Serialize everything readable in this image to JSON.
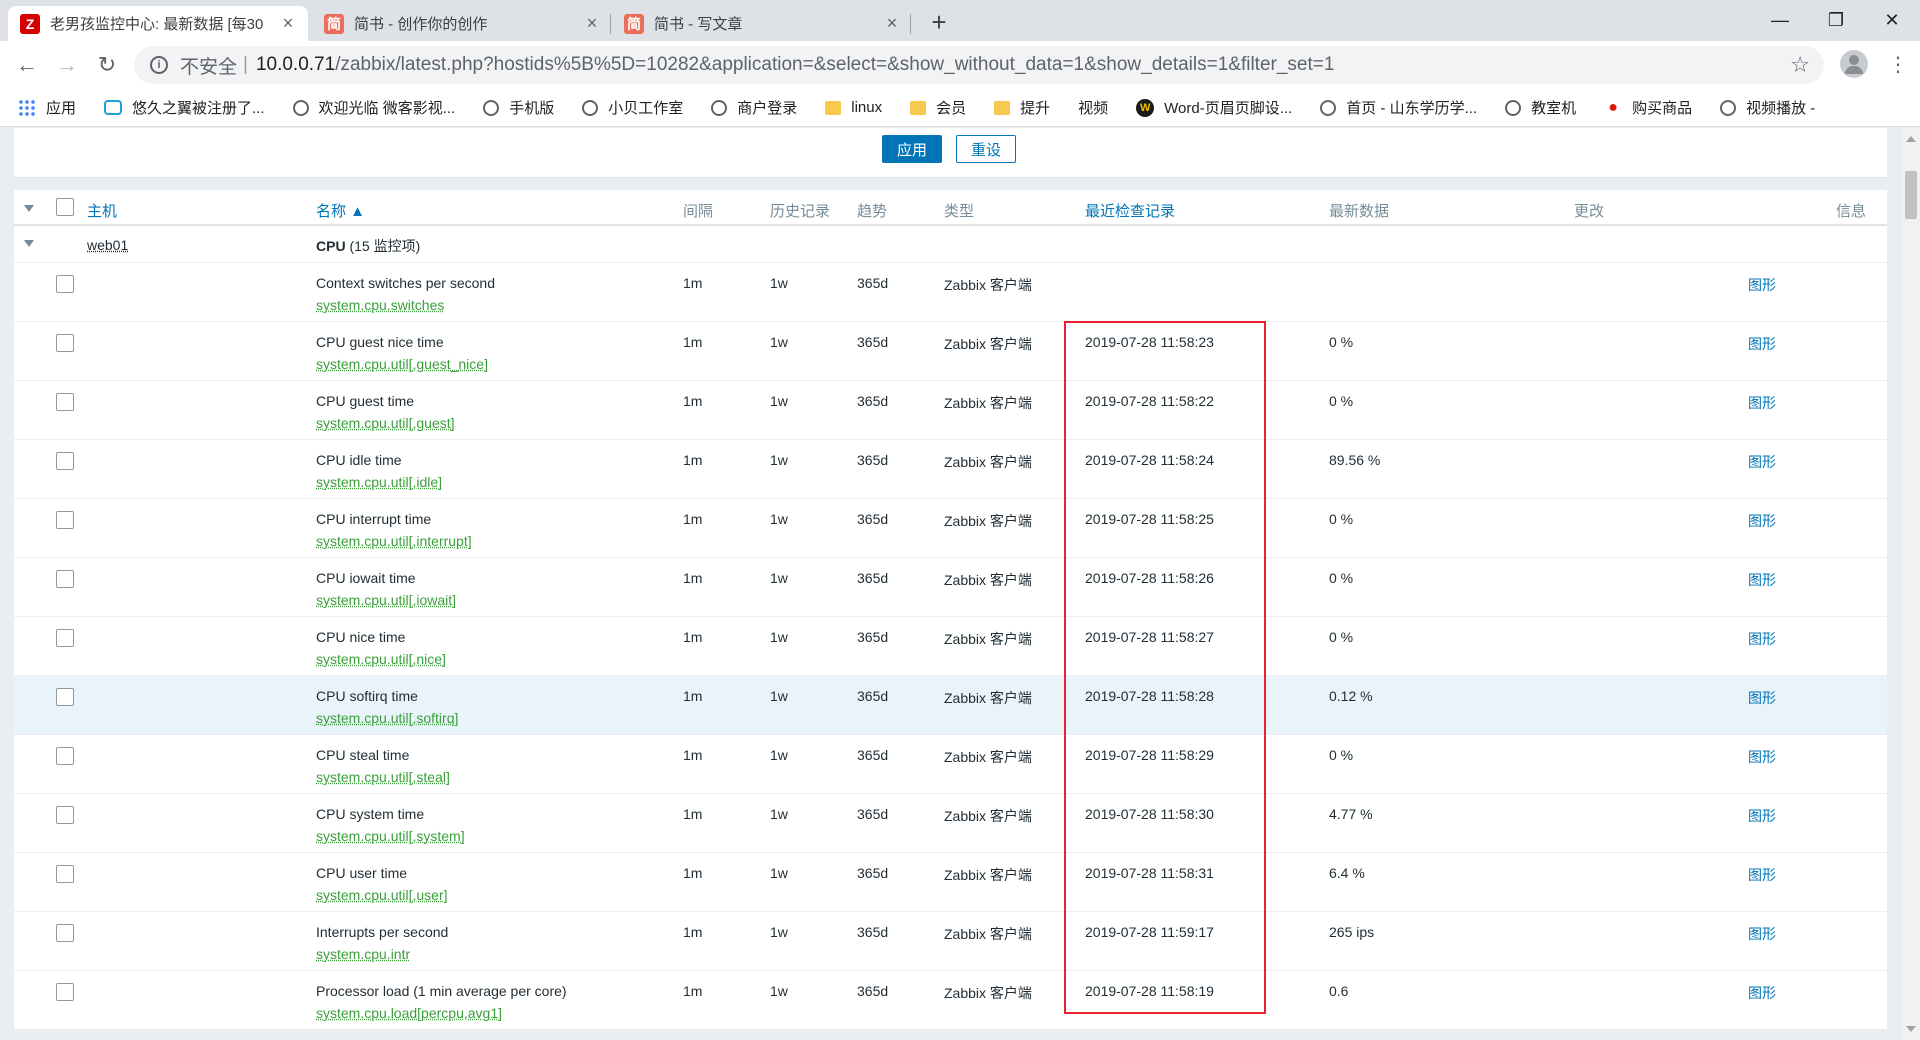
{
  "browser": {
    "tabs": [
      {
        "title": "老男孩监控中心: 最新数据 [每30",
        "favicon": "Z",
        "active": true
      },
      {
        "title": "简书 - 创作你的创作",
        "favicon": "简",
        "active": false
      },
      {
        "title": "简书 - 写文章",
        "favicon": "简",
        "active": false
      }
    ],
    "url": {
      "security_label": "不安全",
      "host": "10.0.0.71",
      "path": "/zabbix/latest.php?hostids%5B%5D=10282&application=&select=&show_without_data=1&show_details=1&filter_set=1"
    },
    "bookmarks": [
      {
        "label": "应用",
        "icon": "apps-icon"
      },
      {
        "label": "悠久之翼被注册了...",
        "icon": "bilibili-icon"
      },
      {
        "label": "欢迎光临 微客影视...",
        "icon": "globe-icon"
      },
      {
        "label": "手机版",
        "icon": "globe-icon"
      },
      {
        "label": "小贝工作室",
        "icon": "globe-icon"
      },
      {
        "label": "商户登录",
        "icon": "globe-icon"
      },
      {
        "label": "linux",
        "icon": "folder-icon"
      },
      {
        "label": "会员",
        "icon": "folder-icon"
      },
      {
        "label": "提升",
        "icon": "folder-icon"
      },
      {
        "label": "视频",
        "icon": "none"
      },
      {
        "label": "Word-页眉页脚设...",
        "icon": "word-icon"
      },
      {
        "label": "首页 - 山东学历学...",
        "icon": "globe-icon"
      },
      {
        "label": "教室机",
        "icon": "globe-icon"
      },
      {
        "label": "购买商品",
        "icon": "qq-icon"
      },
      {
        "label": "视频播放 -",
        "icon": "globe-icon"
      }
    ]
  },
  "filter": {
    "apply_label": "应用",
    "reset_label": "重设"
  },
  "table": {
    "headers": {
      "host": "主机",
      "name": "名称 ▲",
      "interval": "间隔",
      "history": "历史记录",
      "trends": "趋势",
      "type": "类型",
      "last_check": "最近检查记录",
      "last_value": "最新数据",
      "change": "更改",
      "info": "信息"
    },
    "host": "web01",
    "group": {
      "name": "CPU",
      "count": "(15 监控项)"
    },
    "graph_label": "图形",
    "rows": [
      {
        "name": "Context switches per second",
        "key": "system.cpu.switches",
        "interval": "1m",
        "history": "1w",
        "trends": "365d",
        "type": "Zabbix 客户端",
        "last_check": "",
        "last_value": "",
        "highlight": false
      },
      {
        "name": "CPU guest nice time",
        "key": "system.cpu.util[,guest_nice]",
        "interval": "1m",
        "history": "1w",
        "trends": "365d",
        "type": "Zabbix 客户端",
        "last_check": "2019-07-28 11:58:23",
        "last_value": "0 %",
        "highlight": false
      },
      {
        "name": "CPU guest time",
        "key": "system.cpu.util[,guest]",
        "interval": "1m",
        "history": "1w",
        "trends": "365d",
        "type": "Zabbix 客户端",
        "last_check": "2019-07-28 11:58:22",
        "last_value": "0 %",
        "highlight": false
      },
      {
        "name": "CPU idle time",
        "key": "system.cpu.util[,idle]",
        "interval": "1m",
        "history": "1w",
        "trends": "365d",
        "type": "Zabbix 客户端",
        "last_check": "2019-07-28 11:58:24",
        "last_value": "89.56 %",
        "highlight": false
      },
      {
        "name": "CPU interrupt time",
        "key": "system.cpu.util[,interrupt]",
        "interval": "1m",
        "history": "1w",
        "trends": "365d",
        "type": "Zabbix 客户端",
        "last_check": "2019-07-28 11:58:25",
        "last_value": "0 %",
        "highlight": false
      },
      {
        "name": "CPU iowait time",
        "key": "system.cpu.util[,iowait]",
        "interval": "1m",
        "history": "1w",
        "trends": "365d",
        "type": "Zabbix 客户端",
        "last_check": "2019-07-28 11:58:26",
        "last_value": "0 %",
        "highlight": false
      },
      {
        "name": "CPU nice time",
        "key": "system.cpu.util[,nice]",
        "interval": "1m",
        "history": "1w",
        "trends": "365d",
        "type": "Zabbix 客户端",
        "last_check": "2019-07-28 11:58:27",
        "last_value": "0 %",
        "highlight": false
      },
      {
        "name": "CPU softirq time",
        "key": "system.cpu.util[,softirq]",
        "interval": "1m",
        "history": "1w",
        "trends": "365d",
        "type": "Zabbix 客户端",
        "last_check": "2019-07-28 11:58:28",
        "last_value": "0.12 %",
        "highlight": true
      },
      {
        "name": "CPU steal time",
        "key": "system.cpu.util[,steal]",
        "interval": "1m",
        "history": "1w",
        "trends": "365d",
        "type": "Zabbix 客户端",
        "last_check": "2019-07-28 11:58:29",
        "last_value": "0 %",
        "highlight": false
      },
      {
        "name": "CPU system time",
        "key": "system.cpu.util[,system]",
        "interval": "1m",
        "history": "1w",
        "trends": "365d",
        "type": "Zabbix 客户端",
        "last_check": "2019-07-28 11:58:30",
        "last_value": "4.77 %",
        "highlight": false
      },
      {
        "name": "CPU user time",
        "key": "system.cpu.util[,user]",
        "interval": "1m",
        "history": "1w",
        "trends": "365d",
        "type": "Zabbix 客户端",
        "last_check": "2019-07-28 11:58:31",
        "last_value": "6.4 %",
        "highlight": false
      },
      {
        "name": "Interrupts per second",
        "key": "system.cpu.intr",
        "interval": "1m",
        "history": "1w",
        "trends": "365d",
        "type": "Zabbix 客户端",
        "last_check": "2019-07-28 11:59:17",
        "last_value": "265 ips",
        "highlight": false
      },
      {
        "name": "Processor load (1 min average per core)",
        "key": "system.cpu.load[percpu,avg1]",
        "interval": "1m",
        "history": "1w",
        "trends": "365d",
        "type": "Zabbix 客户端",
        "last_check": "2019-07-28 11:58:19",
        "last_value": "0.6",
        "highlight": false
      }
    ]
  },
  "colors": {
    "zabbix_blue": "#0275b8",
    "item_key_green": "#3aa03a",
    "annotation_red": "#e8232f",
    "row_highlight": "#e8f4fa"
  }
}
